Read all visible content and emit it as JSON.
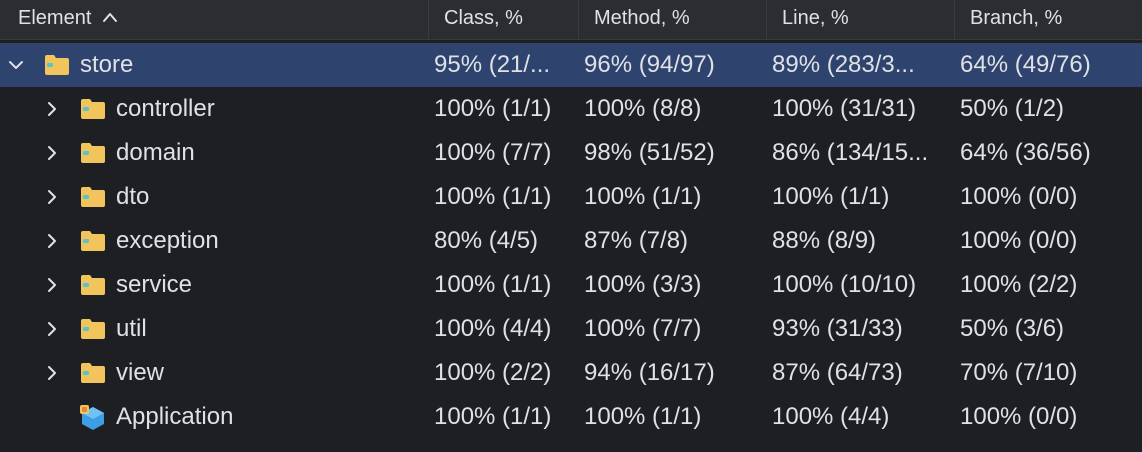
{
  "header": {
    "element": "Element",
    "class_pct": "Class, %",
    "method_pct": "Method, %",
    "line_pct": "Line, %",
    "branch_pct": "Branch, %"
  },
  "rows": [
    {
      "name": "store",
      "class": "95% (21/...",
      "method": "96% (94/97)",
      "line": "89% (283/3...",
      "branch": "64% (49/76)"
    },
    {
      "name": "controller",
      "class": "100% (1/1)",
      "method": "100% (8/8)",
      "line": "100% (31/31)",
      "branch": "50% (1/2)"
    },
    {
      "name": "domain",
      "class": "100% (7/7)",
      "method": "98% (51/52)",
      "line": "86% (134/15...",
      "branch": "64% (36/56)"
    },
    {
      "name": "dto",
      "class": "100% (1/1)",
      "method": "100% (1/1)",
      "line": "100% (1/1)",
      "branch": "100% (0/0)"
    },
    {
      "name": "exception",
      "class": "80% (4/5)",
      "method": "87% (7/8)",
      "line": "88% (8/9)",
      "branch": "100% (0/0)"
    },
    {
      "name": "service",
      "class": "100% (1/1)",
      "method": "100% (3/3)",
      "line": "100% (10/10)",
      "branch": "100% (2/2)"
    },
    {
      "name": "util",
      "class": "100% (4/4)",
      "method": "100% (7/7)",
      "line": "93% (31/33)",
      "branch": "50% (3/6)"
    },
    {
      "name": "view",
      "class": "100% (2/2)",
      "method": "94% (16/17)",
      "line": "87% (64/73)",
      "branch": "70% (7/10)"
    },
    {
      "name": "Application",
      "class": "100% (1/1)",
      "method": "100% (1/1)",
      "line": "100% (4/4)",
      "branch": "100% (0/0)"
    }
  ],
  "colors": {
    "background": "#1e1f22",
    "header_bg": "#2b2d30",
    "selection": "#2e436e",
    "text": "#dfe1e5",
    "folder": "#f2c55c",
    "app_icon": "#3d9ee6"
  },
  "icons": {
    "sort": "chevron-up-icon",
    "expanded": "chevron-down-icon",
    "collapsed": "chevron-right-icon",
    "folder": "folder-icon",
    "class": "application-class-icon"
  }
}
